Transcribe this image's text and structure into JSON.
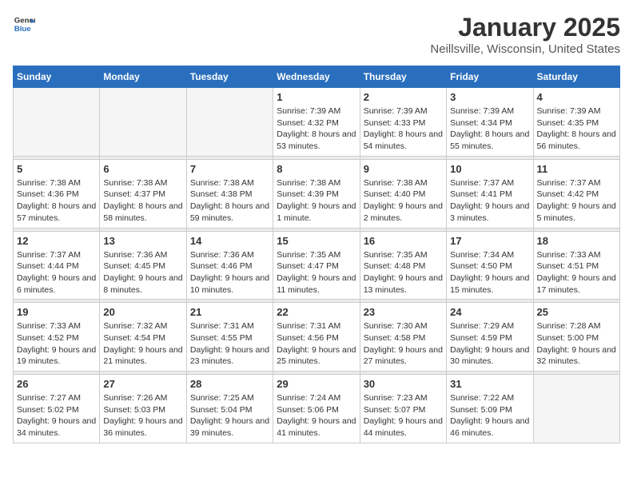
{
  "header": {
    "logo_general": "General",
    "logo_blue": "Blue",
    "month": "January 2025",
    "location": "Neillsville, Wisconsin, United States"
  },
  "weekdays": [
    "Sunday",
    "Monday",
    "Tuesday",
    "Wednesday",
    "Thursday",
    "Friday",
    "Saturday"
  ],
  "weeks": [
    [
      {
        "day": "",
        "info": ""
      },
      {
        "day": "",
        "info": ""
      },
      {
        "day": "",
        "info": ""
      },
      {
        "day": "1",
        "info": "Sunrise: 7:39 AM\nSunset: 4:32 PM\nDaylight: 8 hours and 53 minutes."
      },
      {
        "day": "2",
        "info": "Sunrise: 7:39 AM\nSunset: 4:33 PM\nDaylight: 8 hours and 54 minutes."
      },
      {
        "day": "3",
        "info": "Sunrise: 7:39 AM\nSunset: 4:34 PM\nDaylight: 8 hours and 55 minutes."
      },
      {
        "day": "4",
        "info": "Sunrise: 7:39 AM\nSunset: 4:35 PM\nDaylight: 8 hours and 56 minutes."
      }
    ],
    [
      {
        "day": "5",
        "info": "Sunrise: 7:38 AM\nSunset: 4:36 PM\nDaylight: 8 hours and 57 minutes."
      },
      {
        "day": "6",
        "info": "Sunrise: 7:38 AM\nSunset: 4:37 PM\nDaylight: 8 hours and 58 minutes."
      },
      {
        "day": "7",
        "info": "Sunrise: 7:38 AM\nSunset: 4:38 PM\nDaylight: 8 hours and 59 minutes."
      },
      {
        "day": "8",
        "info": "Sunrise: 7:38 AM\nSunset: 4:39 PM\nDaylight: 9 hours and 1 minute."
      },
      {
        "day": "9",
        "info": "Sunrise: 7:38 AM\nSunset: 4:40 PM\nDaylight: 9 hours and 2 minutes."
      },
      {
        "day": "10",
        "info": "Sunrise: 7:37 AM\nSunset: 4:41 PM\nDaylight: 9 hours and 3 minutes."
      },
      {
        "day": "11",
        "info": "Sunrise: 7:37 AM\nSunset: 4:42 PM\nDaylight: 9 hours and 5 minutes."
      }
    ],
    [
      {
        "day": "12",
        "info": "Sunrise: 7:37 AM\nSunset: 4:44 PM\nDaylight: 9 hours and 6 minutes."
      },
      {
        "day": "13",
        "info": "Sunrise: 7:36 AM\nSunset: 4:45 PM\nDaylight: 9 hours and 8 minutes."
      },
      {
        "day": "14",
        "info": "Sunrise: 7:36 AM\nSunset: 4:46 PM\nDaylight: 9 hours and 10 minutes."
      },
      {
        "day": "15",
        "info": "Sunrise: 7:35 AM\nSunset: 4:47 PM\nDaylight: 9 hours and 11 minutes."
      },
      {
        "day": "16",
        "info": "Sunrise: 7:35 AM\nSunset: 4:48 PM\nDaylight: 9 hours and 13 minutes."
      },
      {
        "day": "17",
        "info": "Sunrise: 7:34 AM\nSunset: 4:50 PM\nDaylight: 9 hours and 15 minutes."
      },
      {
        "day": "18",
        "info": "Sunrise: 7:33 AM\nSunset: 4:51 PM\nDaylight: 9 hours and 17 minutes."
      }
    ],
    [
      {
        "day": "19",
        "info": "Sunrise: 7:33 AM\nSunset: 4:52 PM\nDaylight: 9 hours and 19 minutes."
      },
      {
        "day": "20",
        "info": "Sunrise: 7:32 AM\nSunset: 4:54 PM\nDaylight: 9 hours and 21 minutes."
      },
      {
        "day": "21",
        "info": "Sunrise: 7:31 AM\nSunset: 4:55 PM\nDaylight: 9 hours and 23 minutes."
      },
      {
        "day": "22",
        "info": "Sunrise: 7:31 AM\nSunset: 4:56 PM\nDaylight: 9 hours and 25 minutes."
      },
      {
        "day": "23",
        "info": "Sunrise: 7:30 AM\nSunset: 4:58 PM\nDaylight: 9 hours and 27 minutes."
      },
      {
        "day": "24",
        "info": "Sunrise: 7:29 AM\nSunset: 4:59 PM\nDaylight: 9 hours and 30 minutes."
      },
      {
        "day": "25",
        "info": "Sunrise: 7:28 AM\nSunset: 5:00 PM\nDaylight: 9 hours and 32 minutes."
      }
    ],
    [
      {
        "day": "26",
        "info": "Sunrise: 7:27 AM\nSunset: 5:02 PM\nDaylight: 9 hours and 34 minutes."
      },
      {
        "day": "27",
        "info": "Sunrise: 7:26 AM\nSunset: 5:03 PM\nDaylight: 9 hours and 36 minutes."
      },
      {
        "day": "28",
        "info": "Sunrise: 7:25 AM\nSunset: 5:04 PM\nDaylight: 9 hours and 39 minutes."
      },
      {
        "day": "29",
        "info": "Sunrise: 7:24 AM\nSunset: 5:06 PM\nDaylight: 9 hours and 41 minutes."
      },
      {
        "day": "30",
        "info": "Sunrise: 7:23 AM\nSunset: 5:07 PM\nDaylight: 9 hours and 44 minutes."
      },
      {
        "day": "31",
        "info": "Sunrise: 7:22 AM\nSunset: 5:09 PM\nDaylight: 9 hours and 46 minutes."
      },
      {
        "day": "",
        "info": ""
      }
    ]
  ]
}
